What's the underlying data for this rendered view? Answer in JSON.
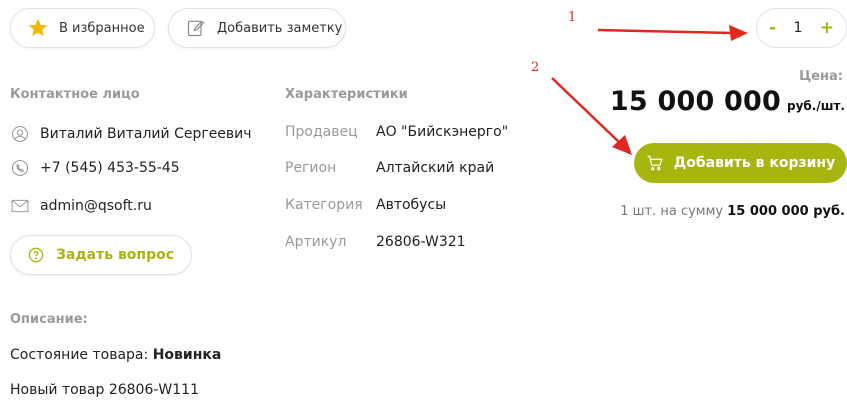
{
  "toolbar": {
    "favorite_label": "В избранное",
    "note_label": "Добавить заметку"
  },
  "quantity": {
    "minus": "-",
    "value": "1",
    "plus": "+"
  },
  "contact": {
    "heading": "Контактное лицо",
    "name": "Виталий Виталий Сергеевич",
    "phone": "+7 (545) 453-55-45",
    "email": "admin@qsoft.ru",
    "ask_button": "Задать вопрос"
  },
  "characteristics": {
    "heading": "Характеристики",
    "rows": [
      {
        "key": "Продавец",
        "value": "АО \"Бийскэнерго\""
      },
      {
        "key": "Регион",
        "value": "Алтайский край"
      },
      {
        "key": "Категория",
        "value": "Автобусы"
      },
      {
        "key": "Артикул",
        "value": "26806-W321"
      }
    ]
  },
  "price": {
    "label": "Цена:",
    "value": "15 000 000",
    "unit": "руб./шт."
  },
  "cart": {
    "button": "Добавить в корзину",
    "sum_prefix": "1 шт. на сумму",
    "sum_value": "15 000 000 руб."
  },
  "description": {
    "heading": "Описание:",
    "condition_label": "Состояние товара:",
    "condition_value": "Новинка",
    "text": "Новый товар 26806-W111"
  },
  "annotations": {
    "first": "1",
    "second": "2"
  },
  "colors": {
    "accent": "#a7b50f",
    "star": "#f5b800",
    "annotation": "#e0281f"
  }
}
